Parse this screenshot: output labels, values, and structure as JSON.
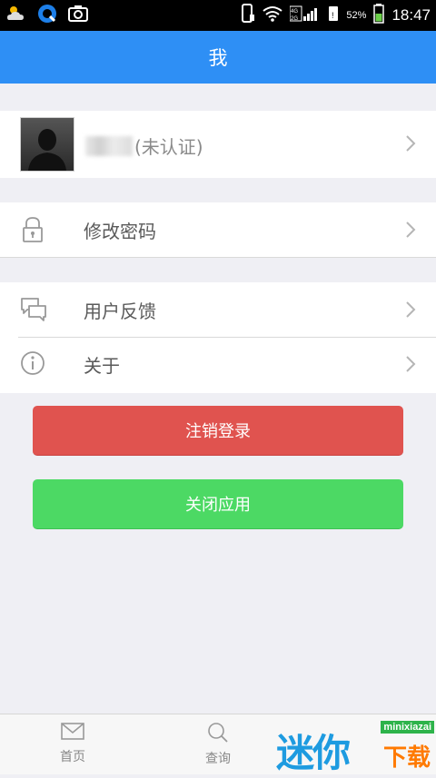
{
  "status_bar": {
    "battery_percent": "52%",
    "time": "18:47",
    "network": "4G 2G",
    "icons": [
      "weather-icon",
      "qq-browser-icon",
      "screenshot-icon",
      "phone-icon",
      "wifi-icon",
      "signal-icon",
      "sim-icon",
      "battery-icon"
    ]
  },
  "header": {
    "title": "我"
  },
  "profile": {
    "name_blurred": true,
    "status": "(未认证)"
  },
  "menu": {
    "change_password": "修改密码",
    "feedback": "用户反馈",
    "about": "关于"
  },
  "buttons": {
    "logout": "注销登录",
    "close_app": "关闭应用"
  },
  "bottom_nav": {
    "home": "首页",
    "search": "查询"
  },
  "watermark": {
    "brand": "迷你",
    "domain": "minixiazai",
    "download": "下载"
  },
  "colors": {
    "header": "#2e8ff5",
    "logout": "#e0534f",
    "close_app": "#4cd964",
    "background": "#efeff4"
  }
}
